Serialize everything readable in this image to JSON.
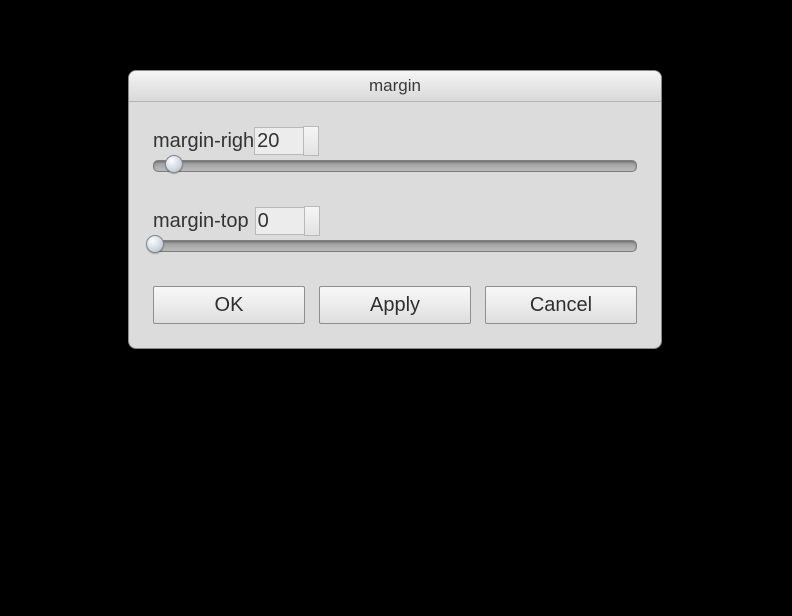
{
  "dialog": {
    "title": "margin",
    "sliders": [
      {
        "label": "margin-righ",
        "value": "20",
        "thumb_percent": 4
      },
      {
        "label": "margin-top",
        "value": "0",
        "thumb_percent": 0
      }
    ],
    "buttons": {
      "ok": "OK",
      "apply": "Apply",
      "cancel": "Cancel"
    }
  }
}
